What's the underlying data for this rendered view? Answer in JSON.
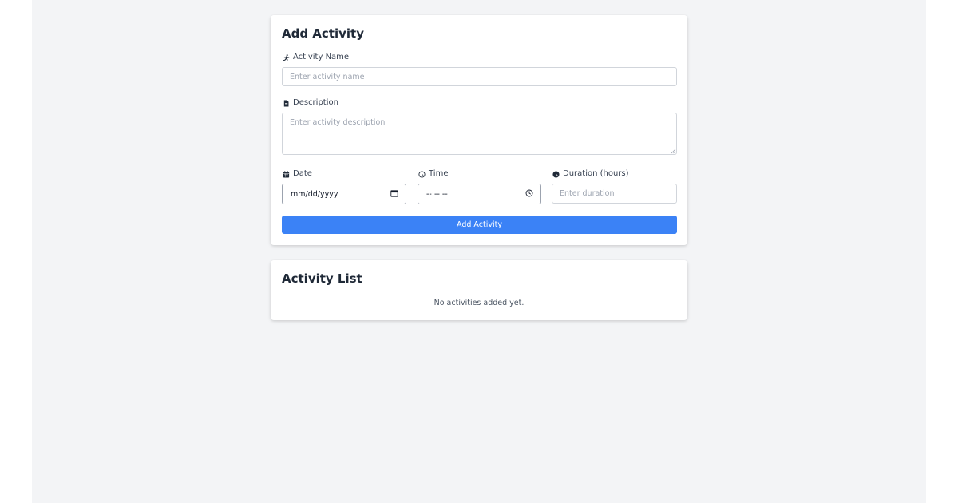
{
  "form": {
    "title": "Add Activity",
    "name_label": "Activity Name",
    "name_placeholder": "Enter activity name",
    "description_label": "Description",
    "description_placeholder": "Enter activity description",
    "date_label": "Date",
    "date_placeholder": "mm/dd/yyyy",
    "time_label": "Time",
    "time_placeholder": "--:-- --",
    "duration_label": "Duration (hours)",
    "duration_placeholder": "Enter duration",
    "submit_label": "Add Activity"
  },
  "list": {
    "title": "Activity List",
    "empty_message": "No activities added yet."
  },
  "icons": {
    "name": "running-icon",
    "description": "file-icon",
    "date": "calendar-icon",
    "time": "clock-outline-icon",
    "duration": "clock-solid-icon",
    "date_picker": "calendar-picker-icon",
    "time_picker": "clock-picker-icon"
  },
  "colors": {
    "page_background": "#f3f4f6",
    "card_background": "#ffffff",
    "primary_button": "#3b82f6",
    "heading_text": "#1f2937",
    "muted_text": "#4b5563",
    "placeholder_text": "#9ca3af",
    "border": "#d1d5db"
  }
}
